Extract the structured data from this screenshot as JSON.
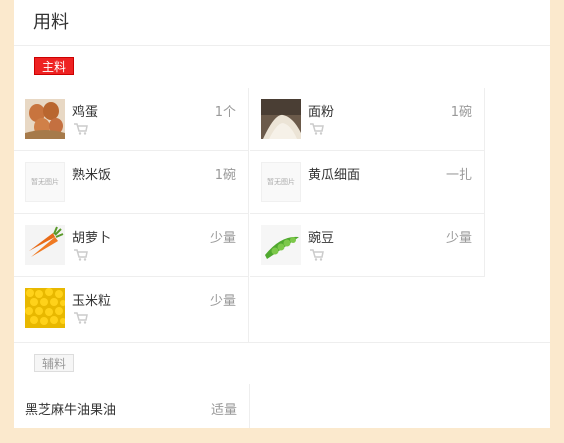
{
  "header": {
    "title": "用料"
  },
  "main_section": {
    "tag": "主料",
    "ingredients": [
      {
        "name": "鸡蛋",
        "amount": "1个",
        "image": "eggs-photo",
        "has_cart": true
      },
      {
        "name": "面粉",
        "amount": "1碗",
        "image": "flour-photo",
        "has_cart": true
      },
      {
        "name": "熟米饭",
        "amount": "1碗",
        "image": "placeholder",
        "placeholder_text": "暂无图片",
        "has_cart": false
      },
      {
        "name": "黄瓜细面",
        "amount": "一扎",
        "image": "placeholder",
        "placeholder_text": "暂无图片",
        "has_cart": false
      },
      {
        "name": "胡萝卜",
        "amount": "少量",
        "image": "carrot-photo",
        "has_cart": true
      },
      {
        "name": "豌豆",
        "amount": "少量",
        "image": "peas-photo",
        "has_cart": true
      },
      {
        "name": "玉米粒",
        "amount": "少量",
        "image": "corn-photo",
        "has_cart": true
      }
    ]
  },
  "aux_section": {
    "tag": "辅料",
    "ingredients": [
      {
        "name": "黑芝麻牛油果油",
        "amount": "适量"
      }
    ]
  },
  "icons": {
    "cart": "shopping-cart-icon"
  }
}
